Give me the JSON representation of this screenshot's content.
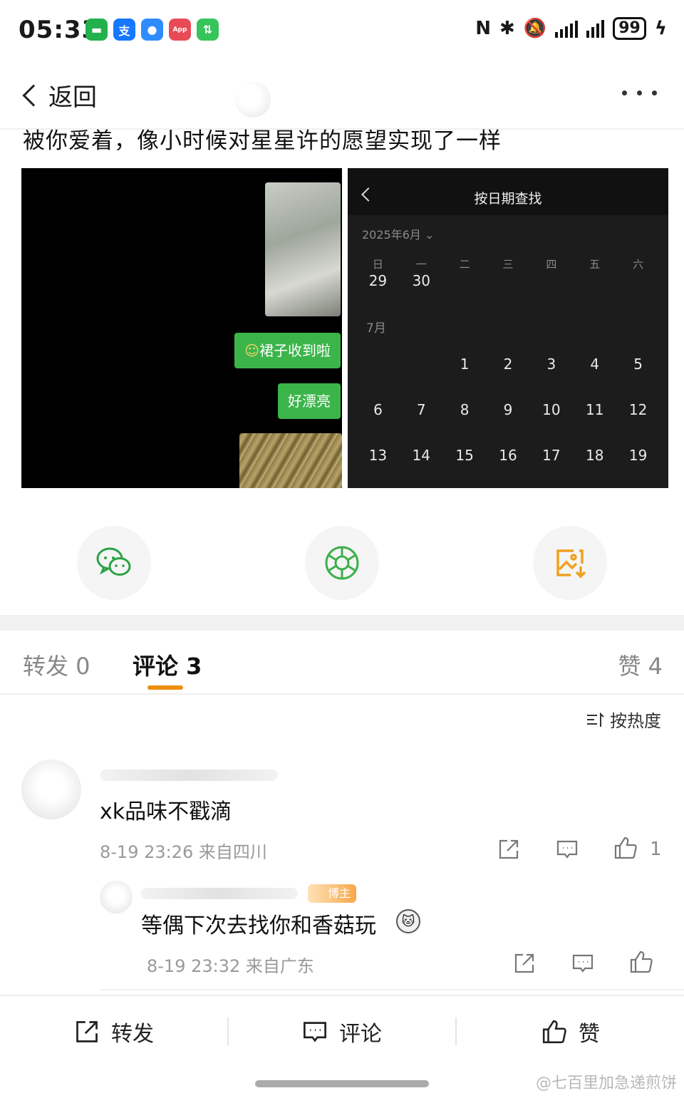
{
  "status_bar": {
    "time": "05:33",
    "apps": [
      {
        "icon": "wechat-app-icon",
        "glyph": "▬",
        "color": "#22b14c"
      },
      {
        "icon": "alipay-app-icon",
        "glyph": "支",
        "color": "#1677ff"
      },
      {
        "icon": "messages-app-icon",
        "glyph": "●",
        "color": "#2f8cff"
      },
      {
        "icon": "appgallery-app-icon",
        "glyph": "App",
        "color": "#e84b57"
      },
      {
        "icon": "data-transfer-app-icon",
        "glyph": "⇅",
        "color": "#37c45a"
      }
    ],
    "battery": "99"
  },
  "nav": {
    "back_label": "返回"
  },
  "post": {
    "text": "被你爱着，像小时候对星星许的愿望实现了一样",
    "left_image": {
      "bubble1": "裙子收到啦",
      "bubble2": "好漂亮"
    },
    "right_image": {
      "title": "按日期查找",
      "month_select": "2025年6月",
      "weekdays": [
        "日",
        "一",
        "二",
        "三",
        "四",
        "五",
        "六"
      ],
      "row_june": [
        "29",
        "30",
        "",
        "",
        "",
        "",
        ""
      ],
      "july_label": "7月",
      "row1": [
        "",
        "",
        "1",
        "2",
        "3",
        "4",
        "5"
      ],
      "row2": [
        "6",
        "7",
        "8",
        "9",
        "10",
        "11",
        "12"
      ],
      "row3": [
        "13",
        "14",
        "15",
        "16",
        "17",
        "18",
        "19"
      ]
    }
  },
  "share": {
    "wechat_color": "#2ba245",
    "moments_color": "#3db04a",
    "save_color": "#f0a020"
  },
  "tabs": {
    "repost": "转发 0",
    "comment": "评论 3",
    "like": "赞 4"
  },
  "sort": {
    "label": "按热度"
  },
  "comments": [
    {
      "text": "xk品味不戳滴",
      "meta": "8-19 23:26 来自四川",
      "likes": "1"
    },
    {
      "badge": "博主",
      "text": "等偶下次去找你和香菇玩",
      "meta": "8-19 23:32 来自广东",
      "likes": ""
    }
  ],
  "bottom_bar": {
    "repost": "转发",
    "comment": "评论",
    "like": "赞"
  },
  "watermark": "@七百里加急递煎饼"
}
